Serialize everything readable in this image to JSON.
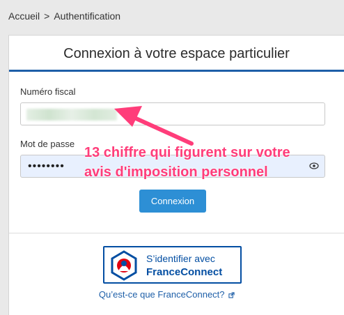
{
  "breadcrumb": {
    "home": "Accueil",
    "separator": ">",
    "current": "Authentification"
  },
  "panel": {
    "title": "Connexion à votre espace particulier"
  },
  "form": {
    "fiscal_label": "Numéro fiscal",
    "fiscal_value": "",
    "password_label": "Mot de passe",
    "password_value": "••••••••",
    "submit_label": "Connexion"
  },
  "franceconnect": {
    "line1": "S’identifier avec",
    "line2": "FranceConnect",
    "link_text": "Qu’est-ce que FranceConnect?"
  },
  "annotation": {
    "line1": "13 chiffre qui figurent sur votre",
    "line2": "avis d'imposition personnel"
  },
  "colors": {
    "accent": "#1e5fa8",
    "button": "#2d8fd5",
    "annotation": "#ff3d7a",
    "franceconnect": "#034ea2"
  }
}
